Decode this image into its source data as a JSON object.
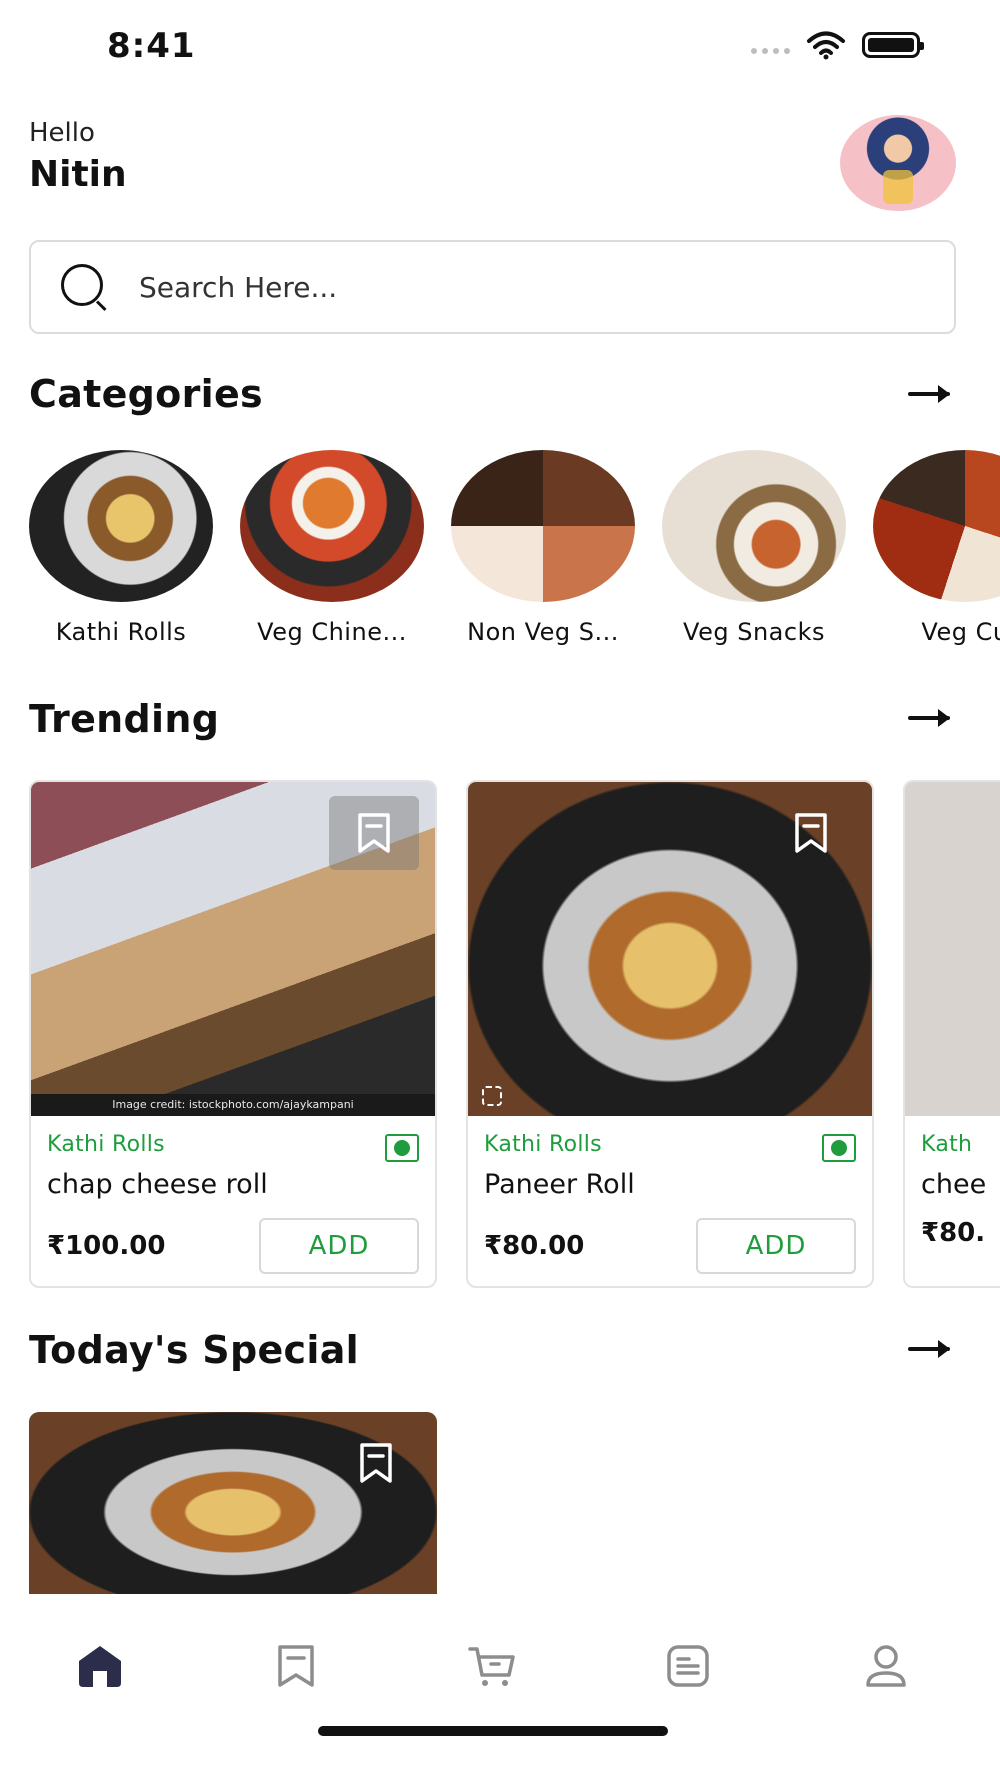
{
  "status_bar": {
    "time": "8:41"
  },
  "greeting": {
    "hello": "Hello",
    "name": "Nitin"
  },
  "search": {
    "placeholder": "Search Here..."
  },
  "sections": {
    "categories": "Categories",
    "trending": "Trending",
    "todays_special": "Today's Special"
  },
  "categories": [
    {
      "label": "Kathi Rolls"
    },
    {
      "label": "Veg Chine..."
    },
    {
      "label": "Non Veg S..."
    },
    {
      "label": "Veg Snacks"
    },
    {
      "label": "Veg Cu"
    }
  ],
  "trending": [
    {
      "category": "Kathi Rolls",
      "name": "chap cheese roll",
      "price": "₹100.00",
      "add_label": "ADD",
      "image_credit": "Image credit: istockphoto.com/ajaykampani"
    },
    {
      "category": "Kathi Rolls",
      "name": "Paneer Roll",
      "price": "₹80.00",
      "add_label": "ADD"
    },
    {
      "category": "Kath",
      "name": "chee",
      "price": "₹80."
    }
  ],
  "icons": {
    "status": [
      "signal-icon",
      "wifi-icon",
      "battery-icon"
    ],
    "nav": [
      "home-icon",
      "bookmark-icon",
      "cart-icon",
      "orders-icon",
      "profile-icon"
    ]
  },
  "colors": {
    "accent_green": "#1f9d3e",
    "nav_active": "#2b2d4a",
    "nav_inactive": "#8d8d8d"
  }
}
